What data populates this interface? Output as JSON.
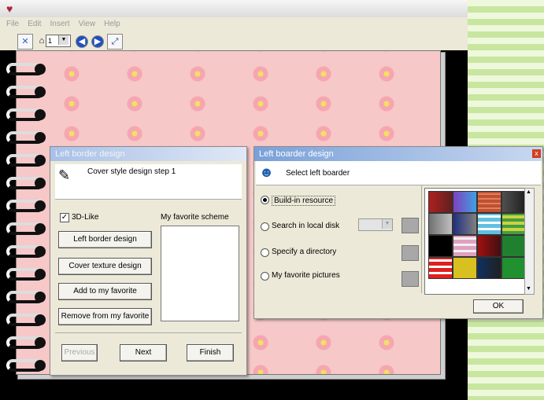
{
  "menu": [
    "File",
    "Edit",
    "Insert",
    "View",
    "Help"
  ],
  "toolbar": {
    "zoom_value": "1",
    "zoom_arrow": "▼"
  },
  "step_dialog": {
    "title": "Left border design",
    "heading": "Cover style design step 1",
    "checkbox_label": "3D-Like",
    "favorite_scheme_label": "My favorite scheme",
    "buttons": [
      "Left border design",
      "Cover texture design",
      "Add to my favorite",
      "Remove from my favorite"
    ],
    "nav": {
      "previous": "Previous",
      "next": "Next",
      "finish": "Finish"
    }
  },
  "border_dialog": {
    "title": "Left boarder design",
    "heading": "Select left boarder",
    "options": [
      "Build-in resource",
      "Search in local disk",
      "Specify a directory",
      "My favorite pictures"
    ],
    "selected_option": "Build-in resource",
    "ok_label": "OK",
    "close_label": "x"
  },
  "colors": {
    "page_pink": "#f6c8c8",
    "stripe_green": "#c8e6a0",
    "title_blue": "#7aa0d8"
  }
}
